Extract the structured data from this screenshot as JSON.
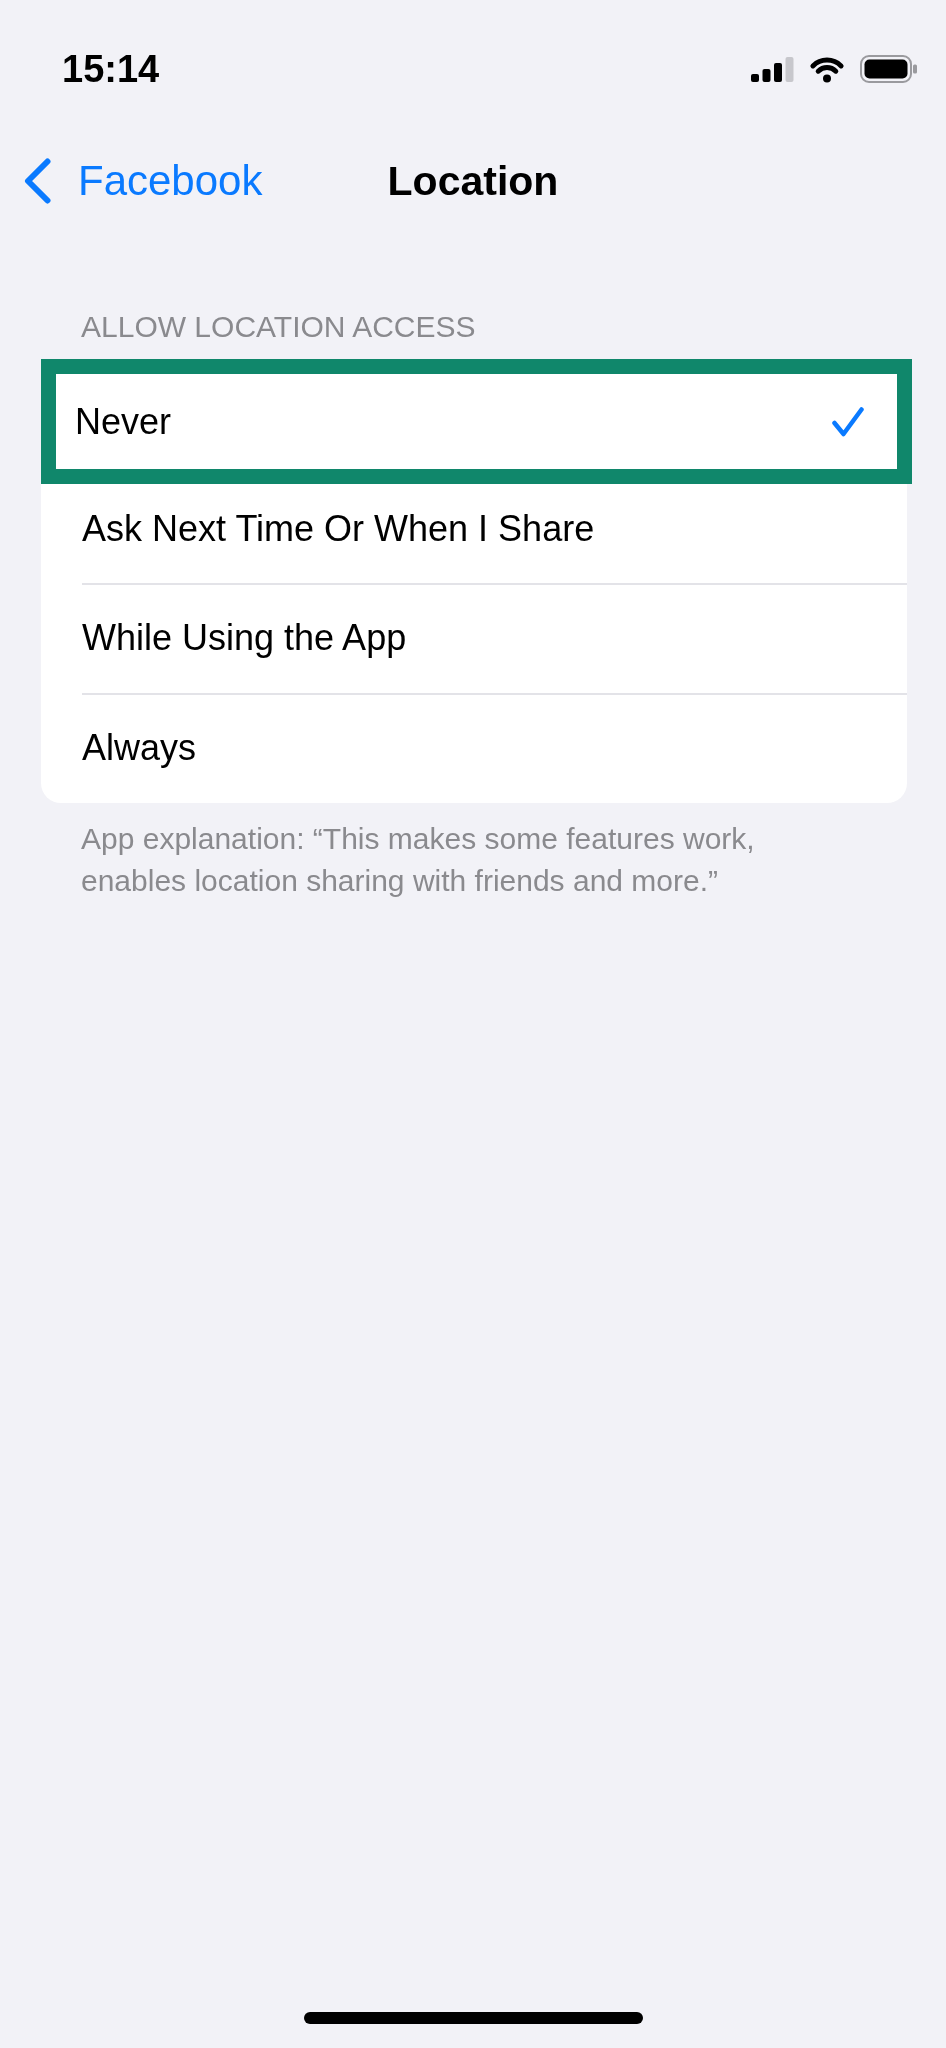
{
  "status_bar": {
    "time": "15:14"
  },
  "nav_bar": {
    "back_label": "Facebook",
    "title": "Location"
  },
  "section": {
    "header": "ALLOW LOCATION ACCESS",
    "options": [
      {
        "label": "Never",
        "selected": true,
        "highlighted": true
      },
      {
        "label": "Ask Next Time Or When I Share",
        "selected": false,
        "highlighted": false
      },
      {
        "label": "While Using the App",
        "selected": false,
        "highlighted": false
      },
      {
        "label": "Always",
        "selected": false,
        "highlighted": false
      }
    ],
    "footer": "App explanation: “This makes some features work, enables location sharing with friends and more.”"
  }
}
